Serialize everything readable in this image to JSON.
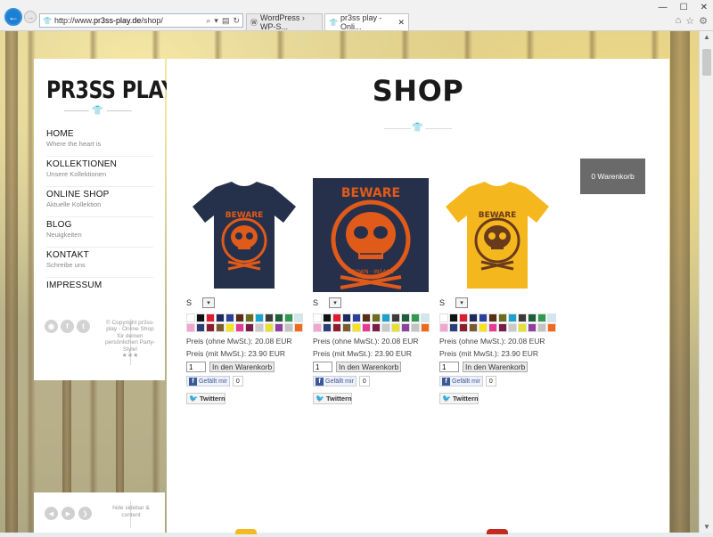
{
  "browser": {
    "url_prefix": "http://www.",
    "url_host": "pr3ss-play.de",
    "url_path": "/shop/",
    "tabs": [
      {
        "label": "WordPress › WP-S..."
      },
      {
        "label": "pr3ss play - Onli..."
      }
    ]
  },
  "sidebar": {
    "logo": "PR3SS PLAY",
    "menu": [
      {
        "label": "HOME",
        "sub": "Where the heart is"
      },
      {
        "label": "KOLLEKTIONEN",
        "sub": "Unsere Kollektionen"
      },
      {
        "label": "ONLINE SHOP",
        "sub": "Aktuelle Kollektion"
      },
      {
        "label": "BLOG",
        "sub": "Neuigkeiten"
      },
      {
        "label": "KONTAKT",
        "sub": "Schreibe uns"
      },
      {
        "label": "IMPRESSUM",
        "sub": ""
      }
    ],
    "copyright": "© Copyright pr3ss-play - Online Shop für deinen persönlichen Party-Style!",
    "stars": "★★★",
    "hide_label": "hide sidebar & content"
  },
  "main": {
    "title": "SHOP",
    "cart_label": "0 Warenkorb"
  },
  "colors": {
    "swatches": [
      "#ffffff",
      "#111111",
      "#e01b2f",
      "#1d2a5e",
      "#2d3f9e",
      "#5a2d16",
      "#6a6d1c",
      "#19a3cf",
      "#3a3a3a",
      "#1e5f3a",
      "#2f9a50",
      "#cfe8ef",
      "#f2a6cf",
      "#2a3f7a",
      "#8b1d2c",
      "#7b5c2e",
      "#f6e41a",
      "#e63a95",
      "#7a1c4a",
      "#c9c9c9",
      "#e8e030",
      "#8e3fa0",
      "#c3c3c3",
      "#f2691a"
    ],
    "shirt_navy": "#25304a",
    "shirt_yellow": "#f5b71e",
    "print_orange": "#e05a1a",
    "print_brown": "#6a3a1c"
  },
  "products": [
    {
      "size": "S",
      "price_net": "Preis (ohne MwSt.): 20.08 EUR",
      "price_gross": "Preis (mit MwSt.): 23.90 EUR",
      "qty": "1",
      "buy_label": "In den Warenkorb",
      "like_label": "Gefällt mir",
      "like_count": "0",
      "tweet_label": "Twittern"
    },
    {
      "size": "S",
      "price_net": "Preis (ohne MwSt.): 20.08 EUR",
      "price_gross": "Preis (mit MwSt.): 23.90 EUR",
      "qty": "1",
      "buy_label": "In den Warenkorb",
      "like_label": "Gefällt mir",
      "like_count": "0",
      "tweet_label": "Twittern"
    },
    {
      "size": "S",
      "price_net": "Preis (ohne MwSt.): 20.08 EUR",
      "price_gross": "Preis (mit MwSt.): 23.90 EUR",
      "qty": "1",
      "buy_label": "In den Warenkorb",
      "like_label": "Gefällt mir",
      "like_count": "0",
      "tweet_label": "Twittern"
    }
  ],
  "print_text": {
    "top": "BEWARE",
    "bottom": "BROWN · INSANE"
  }
}
